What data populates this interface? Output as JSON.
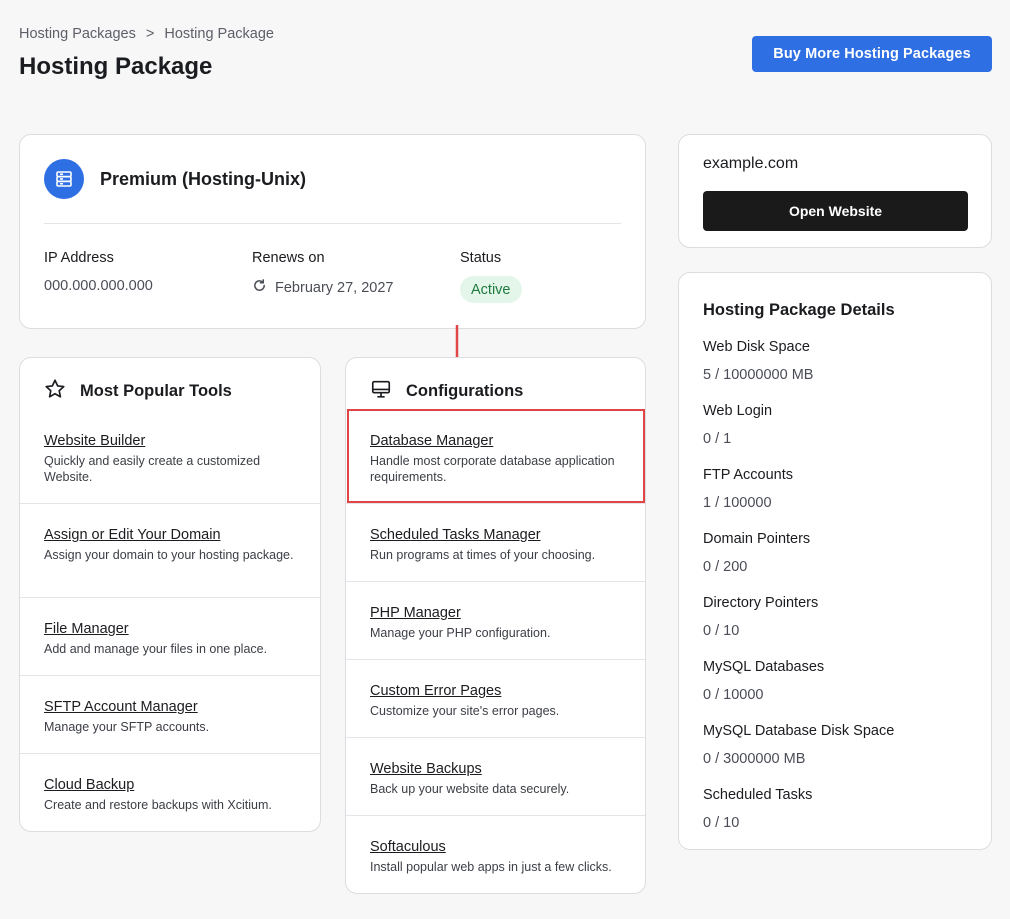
{
  "breadcrumb": {
    "items": [
      "Hosting Packages",
      "Hosting Package"
    ],
    "separator": ">"
  },
  "page": {
    "title": "Hosting Package"
  },
  "header": {
    "buy_button": "Buy More Hosting Packages"
  },
  "package": {
    "name": "Premium (Hosting-Unix)",
    "icon": "server-icon",
    "ip_label": "IP Address",
    "ip_value": "000.000.000.000",
    "renews_label": "Renews on",
    "renews_value": "February 27, 2027",
    "status_label": "Status",
    "status_value": "Active"
  },
  "tools": {
    "title": "Most Popular Tools",
    "icon": "star-icon",
    "items": [
      {
        "name": "Website Builder",
        "desc": "Quickly and easily create a customized Website."
      },
      {
        "name": "Assign or Edit Your Domain",
        "desc": "Assign your domain to your hosting package."
      },
      {
        "name": "File Manager",
        "desc": "Add and manage your files in one place."
      },
      {
        "name": "SFTP Account Manager",
        "desc": "Manage your SFTP accounts."
      },
      {
        "name": "Cloud Backup",
        "desc": "Create and restore backups with Xcitium."
      }
    ]
  },
  "configurations": {
    "title": "Configurations",
    "icon": "monitor-icon",
    "items": [
      {
        "name": "Database Manager",
        "desc": "Handle most corporate database application requirements."
      },
      {
        "name": "Scheduled Tasks Manager",
        "desc": "Run programs at times of your choosing."
      },
      {
        "name": "PHP Manager",
        "desc": "Manage your PHP configuration."
      },
      {
        "name": "Custom Error Pages",
        "desc": "Customize your site's error pages."
      },
      {
        "name": "Website Backups",
        "desc": "Back up your website data securely."
      },
      {
        "name": "Softaculous",
        "desc": "Install popular web apps in just a few clicks."
      }
    ]
  },
  "site": {
    "domain": "example.com",
    "open_button": "Open Website"
  },
  "details": {
    "title": "Hosting Package Details",
    "rows": [
      {
        "label": "Web Disk Space",
        "value": "5 / 10000000 MB"
      },
      {
        "label": "Web Login",
        "value": "0 / 1"
      },
      {
        "label": "FTP Accounts",
        "value": "1 / 100000"
      },
      {
        "label": "Domain Pointers",
        "value": "0 / 200"
      },
      {
        "label": "Directory Pointers",
        "value": "0 / 10"
      },
      {
        "label": "MySQL Databases",
        "value": "0 / 10000"
      },
      {
        "label": "MySQL Database Disk Space",
        "value": "0 / 3000000 MB"
      },
      {
        "label": "Scheduled Tasks",
        "value": "0 / 10"
      }
    ]
  },
  "colors": {
    "accent": "#2f6fe4",
    "highlight": "#e14545",
    "status_bg": "#e4f6ea",
    "status_text": "#1e7a3d"
  }
}
